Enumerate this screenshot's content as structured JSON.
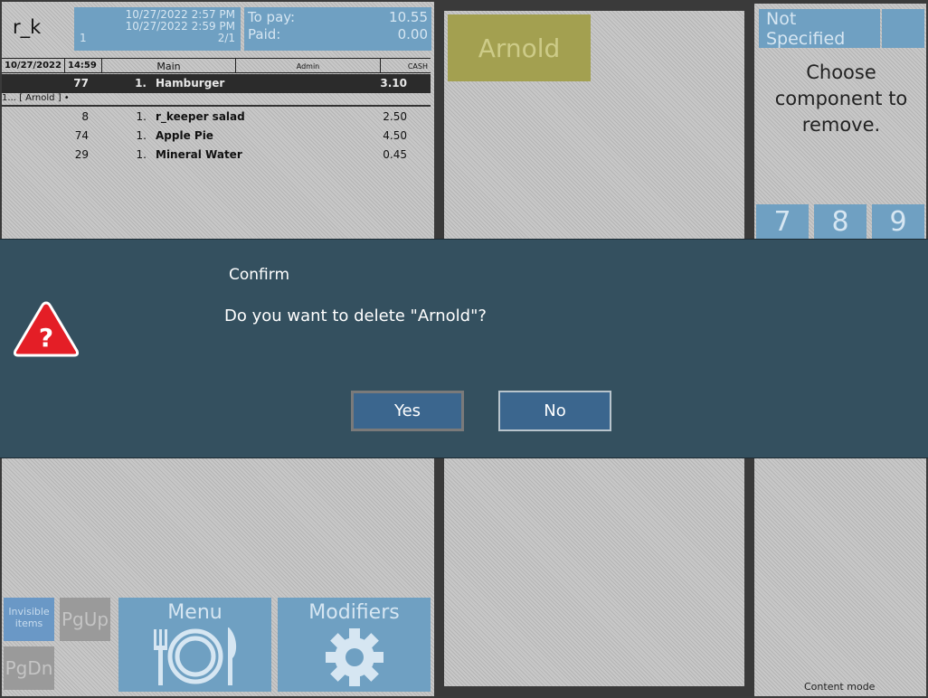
{
  "order": {
    "app_label": "r_k",
    "times": [
      "10/27/2022 2:57 PM",
      "10/27/2022 2:59 PM",
      "1",
      "2/1"
    ],
    "to_pay_label": "To pay:",
    "to_pay_value": "10.55",
    "paid_label": "Paid:",
    "paid_value": "0.00",
    "header": {
      "date": "10/27/2022",
      "time": "14:59",
      "hall": "Main",
      "waiter": "Admin",
      "payment": "CASH"
    },
    "items": [
      {
        "code": "77",
        "qty": "1.",
        "name": "Hamburger",
        "price": "3.10",
        "selected": true
      },
      {
        "code": "8",
        "qty": "1.",
        "name": "r_keeper salad",
        "price": "2.50"
      },
      {
        "code": "74",
        "qty": "1.",
        "name": "Apple Pie",
        "price": "4.50"
      },
      {
        "code": "29",
        "qty": "1.",
        "name": "Mineral Water",
        "price": "0.45"
      }
    ],
    "modifier_tag": "1... [ Arnold ] •"
  },
  "middle": {
    "modifier_button": "Arnold"
  },
  "right": {
    "not_specified": "Not Specified",
    "prompt": "Choose component to remove.",
    "keypad": [
      "7",
      "8",
      "9"
    ],
    "content_mode": "Content mode"
  },
  "dialog": {
    "title": "Confirm",
    "message": "Do you want to delete \"Arnold\"?",
    "yes": "Yes",
    "no": "No",
    "icon_glyph": "?"
  },
  "bottom": {
    "invisible_items": "Invisible items",
    "pgup": "PgUp",
    "pgdn": "PgDn",
    "menu": "Menu",
    "modifiers": "Modifiers"
  },
  "colors": {
    "dialog_bg": "#34505f",
    "dialog_button": "#3b668e",
    "warning_red": "#e41e26",
    "accent_blue": "#6fa0c2",
    "arnold": "#a3a050"
  }
}
